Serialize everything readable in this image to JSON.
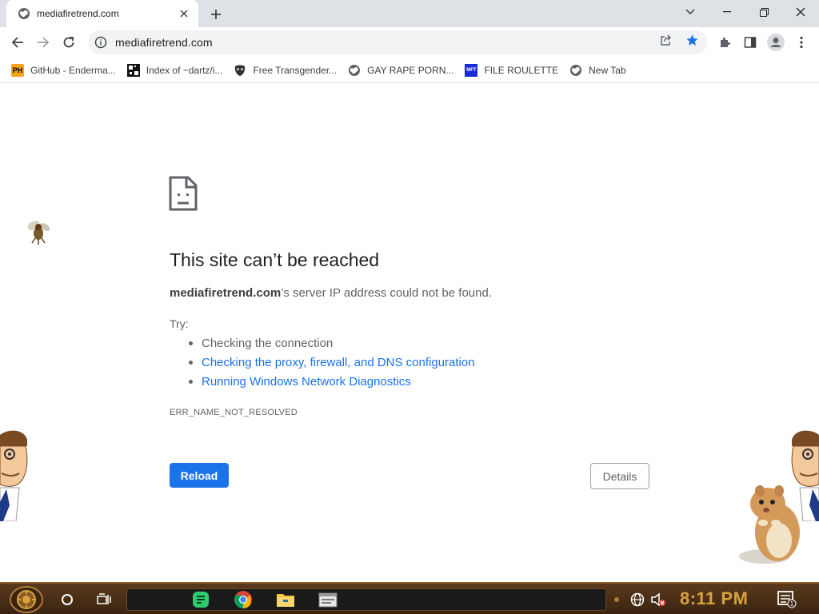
{
  "browser": {
    "tab": {
      "title": "mediafiretrend.com"
    },
    "address_bar": {
      "url": "mediafiretrend.com"
    },
    "bookmarks": [
      {
        "label": "GitHub - Enderma...",
        "icon_text": "PH",
        "icon_color": "#f7a21b"
      },
      {
        "label": "Index of ~dartz/i...",
        "icon_text": "",
        "icon_color": "#000000"
      },
      {
        "label": "Free Transgender...",
        "icon_text": "",
        "icon_color": "#333333"
      },
      {
        "label": "GAY RAPE PORN...",
        "icon_text": "",
        "icon_color": "#5f6368"
      },
      {
        "label": "FILE ROULETTE",
        "icon_text": "MFT",
        "icon_color": "#1a2bd6"
      },
      {
        "label": "New Tab",
        "icon_text": "",
        "icon_color": "#5f6368"
      }
    ]
  },
  "error_page": {
    "title": "This site can’t be reached",
    "domain": "mediafiretrend.com",
    "message_suffix": "’s server IP address could not be found.",
    "try_label": "Try:",
    "suggestions": [
      "Checking the connection",
      "Checking the proxy, firewall, and DNS configuration",
      "Running Windows Network Diagnostics"
    ],
    "error_code": "ERR_NAME_NOT_RESOLVED",
    "reload_label": "Reload",
    "details_label": "Details"
  },
  "taskbar": {
    "clock": "8:11 PM",
    "notification_count": "1"
  },
  "colors": {
    "accent": "#1a73e8",
    "bookmark_star": "#1a73e8",
    "taskbar_clock": "#d8a33a"
  }
}
